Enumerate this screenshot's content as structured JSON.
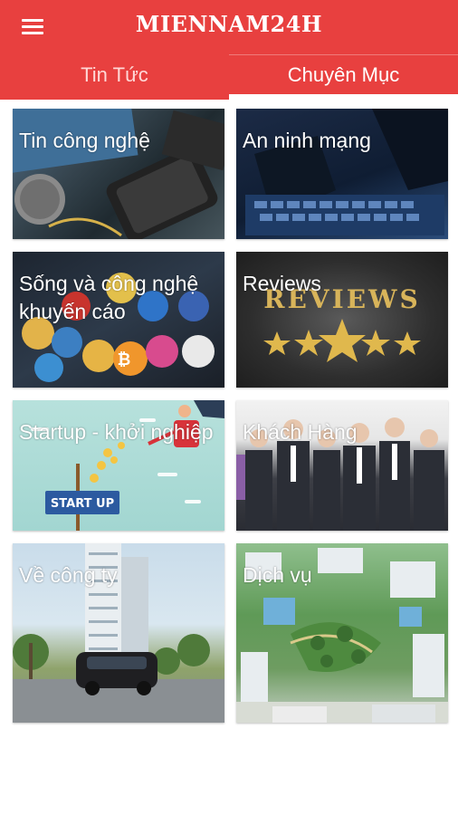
{
  "header": {
    "title": "MIENNAM24H",
    "background": "#e8403f"
  },
  "tabs": [
    {
      "label": "Tin Tức",
      "active": false
    },
    {
      "label": "Chuyên Mục",
      "active": true
    }
  ],
  "categories": [
    {
      "label": "Tin công nghệ"
    },
    {
      "label": "An ninh mạng"
    },
    {
      "label": "Sống và công nghệ khuyến cáo"
    },
    {
      "label": "Reviews",
      "image_text": "REVIEWS"
    },
    {
      "label": "Startup - khởi nghiệp",
      "image_text": "START UP"
    },
    {
      "label": "Khách Hàng"
    },
    {
      "label": "Về công ty"
    },
    {
      "label": "Dịch vụ"
    }
  ]
}
